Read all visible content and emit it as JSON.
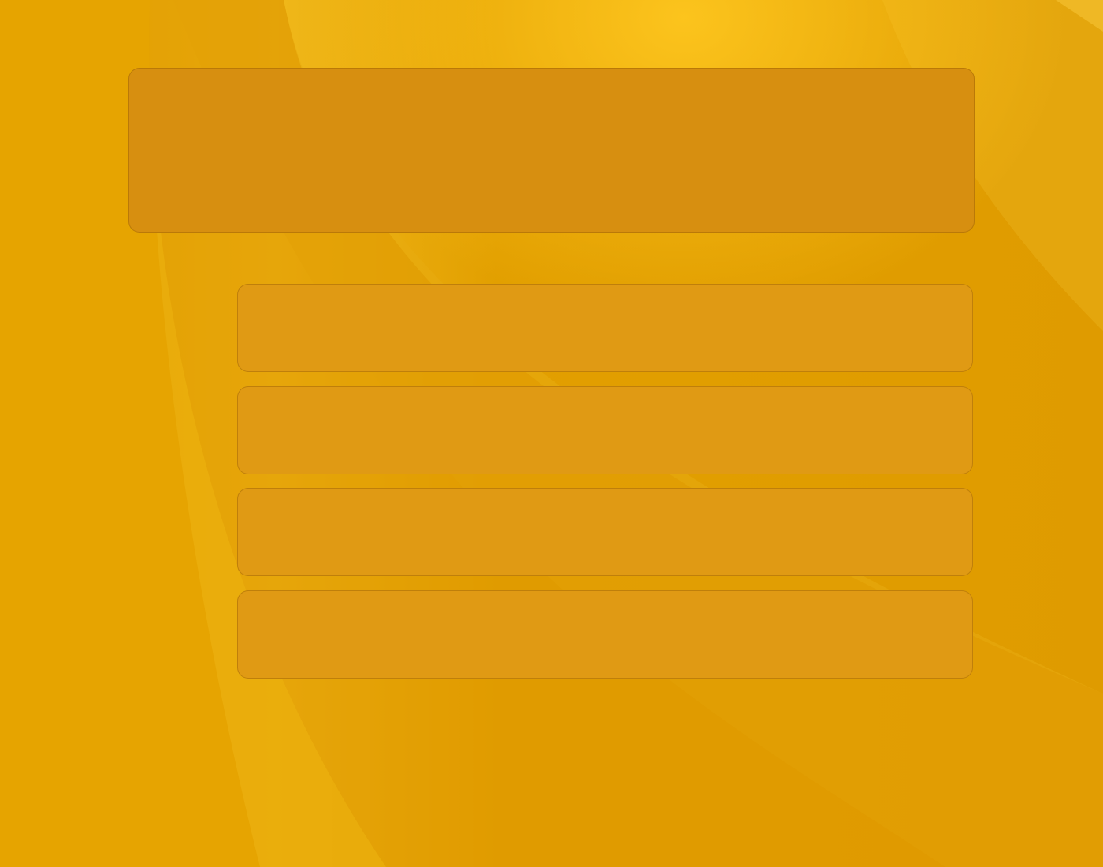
{
  "theme": {
    "background": "#e2a000",
    "header_panel_color": "#d78f10",
    "option_panel_color": "#e09a14",
    "panel_border_color": "#a86a00"
  },
  "header": {
    "title": ""
  },
  "options": [
    {
      "label": ""
    },
    {
      "label": ""
    },
    {
      "label": ""
    },
    {
      "label": ""
    }
  ]
}
